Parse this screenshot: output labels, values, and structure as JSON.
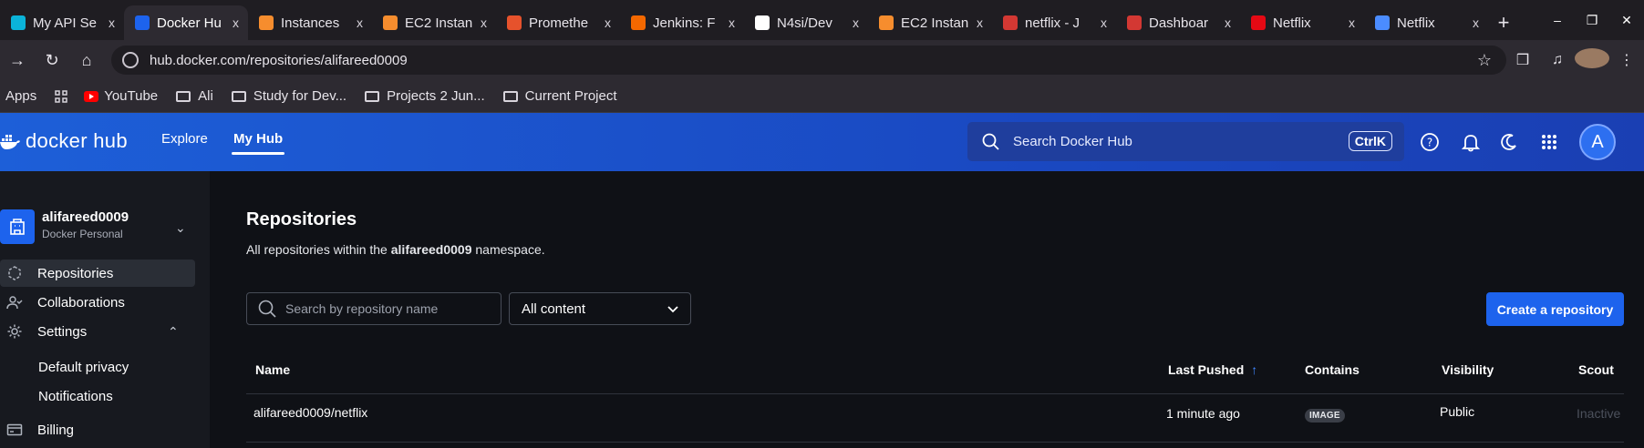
{
  "browser": {
    "tabs": [
      {
        "title": "My API Se",
        "fav_color": "#0bb3d9",
        "active": false
      },
      {
        "title": "Docker Hu",
        "fav_color": "#1d63ed",
        "active": true
      },
      {
        "title": "Instances",
        "fav_color": "#f68d2e",
        "active": false
      },
      {
        "title": "EC2 Instan",
        "fav_color": "#f68d2e",
        "active": false
      },
      {
        "title": "Promethe",
        "fav_color": "#e6522c",
        "active": false
      },
      {
        "title": "Jenkins: F",
        "fav_color": "#f46800",
        "active": false
      },
      {
        "title": "N4si/Dev",
        "fav_color": "#ffffff",
        "active": false
      },
      {
        "title": "EC2 Instan",
        "fav_color": "#f68d2e",
        "active": false
      },
      {
        "title": "netflix - J",
        "fav_color": "#d33833",
        "active": false
      },
      {
        "title": "Dashboar",
        "fav_color": "#d33833",
        "active": false
      },
      {
        "title": "Netflix",
        "fav_color": "#e50914",
        "active": false
      },
      {
        "title": "Netflix",
        "fav_color": "#4b8cff",
        "active": false
      }
    ],
    "close_glyph": "x",
    "new_tab_glyph": "+",
    "url": "hub.docker.com/repositories/alifareed0009",
    "bookmarks": [
      "Apps",
      "YouTube",
      "Ali",
      "Study for Dev...",
      "Projects 2 Jun...",
      "Current Project"
    ]
  },
  "hub": {
    "logo_text": "docker hub",
    "nav": {
      "explore": "Explore",
      "my_hub": "My Hub"
    },
    "search_label": "Search Docker Hub",
    "search_shortcut": "CtrlK",
    "account_initial": "A"
  },
  "sidebar": {
    "org_name": "alifareed0009",
    "org_type": "Docker Personal",
    "items": [
      {
        "label": "Repositories",
        "icon": "repository-icon",
        "active": true
      },
      {
        "label": "Collaborations",
        "icon": "collaborators-icon",
        "active": false
      },
      {
        "label": "Settings",
        "icon": "gear-icon",
        "active": false
      },
      {
        "label": "Billing",
        "icon": "billing-icon",
        "active": false
      }
    ],
    "settings_children": [
      "Default privacy",
      "Notifications"
    ]
  },
  "main": {
    "title": "Repositories",
    "desc_prefix": "All repositories within the ",
    "desc_namespace": "alifareed0009",
    "desc_suffix": " namespace.",
    "search_placeholder": "Search by repository name",
    "filter_value": "All content",
    "create_label": "Create a repository",
    "columns": {
      "name": "Name",
      "last_pushed": "Last Pushed",
      "contains": "Contains",
      "visibility": "Visibility",
      "scout": "Scout"
    },
    "rows": [
      {
        "name": "alifareed0009/netflix",
        "last_pushed": "1 minute ago",
        "contains": "IMAGE",
        "visibility": "Public",
        "scout": "Inactive"
      }
    ]
  },
  "colors": {
    "accent": "#1d63ed",
    "nav_gradient_start": "#1d5fd8",
    "background": "#0f1116"
  }
}
